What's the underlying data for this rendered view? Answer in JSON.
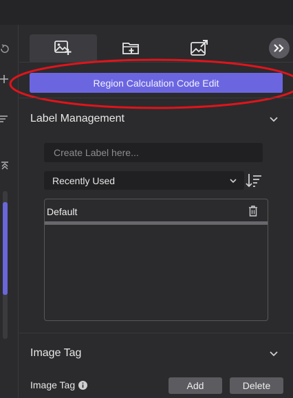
{
  "toolbar": {
    "tabs": [
      {
        "icon": "add-image-icon",
        "active": true
      },
      {
        "icon": "add-folder-icon",
        "active": false
      },
      {
        "icon": "export-image-icon",
        "active": false
      }
    ],
    "expand_icon": "double-chevron-right-icon"
  },
  "primary_button": {
    "label": "Region Calculation Code Edit"
  },
  "label_management": {
    "title": "Label Management",
    "create_placeholder": "Create Label here...",
    "sort_select": {
      "selected": "Recently Used"
    },
    "labels": [
      {
        "name": "Default"
      }
    ]
  },
  "image_tag": {
    "title": "Image Tag",
    "field_label": "Image Tag",
    "add_label": "Add",
    "delete_label": "Delete"
  },
  "colors": {
    "accent": "#6b66e0",
    "annotation": "#e0141b",
    "background": "#2b2b2d"
  }
}
